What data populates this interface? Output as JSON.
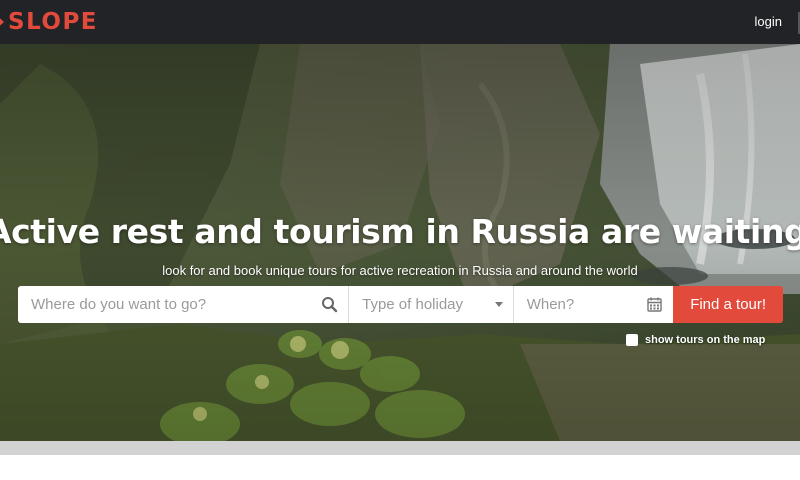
{
  "header": {
    "brand": "SLOPE",
    "login_label": "login"
  },
  "hero": {
    "title": "Active rest and tourism in Russia are waiting for you",
    "subtitle": "look for and book unique tours for active recreation in Russia and around the world"
  },
  "search": {
    "where_placeholder": "Where do you want to go?",
    "holiday_type_placeholder": "Type of holiday",
    "when_placeholder": "When?",
    "submit_label": "Find a tour!"
  },
  "map_toggle": {
    "label": "show tours on the map",
    "checked": false
  },
  "colors": {
    "accent": "#e24a3b",
    "topbar": "#222327"
  },
  "icons": [
    "search-icon",
    "chevron-down-icon",
    "calendar-icon",
    "checkbox"
  ]
}
